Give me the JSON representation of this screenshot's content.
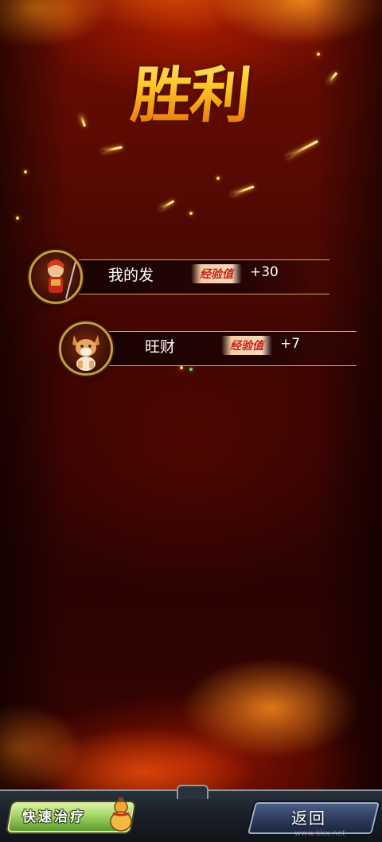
{
  "screen": {
    "title": "胜利"
  },
  "rewards": [
    {
      "name": "我的发",
      "exp_label": "经验值",
      "exp_value": "+30",
      "avatar_icon": "warrior-hero-icon"
    },
    {
      "name": "旺财",
      "exp_label": "经验值",
      "exp_value": "+7",
      "avatar_icon": "dog-pet-icon"
    }
  ],
  "bottom_bar": {
    "quick_heal_label": "快速治疗",
    "back_label": "返回",
    "watermark": "www.kkx.net"
  },
  "colors": {
    "background": "#3c0502",
    "title_gold": "#ffc828",
    "exp_red": "#c8231a",
    "heal_green": "#9fd464",
    "back_blue": "#2c3a5a"
  }
}
